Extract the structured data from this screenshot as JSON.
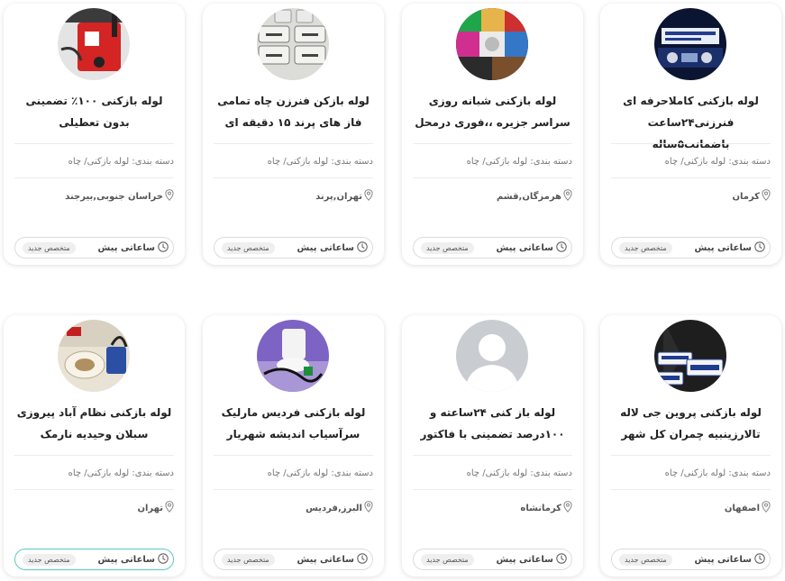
{
  "cards": [
    {
      "title": "لوله بازکنی کاملاحرفه ای فنرزنی۲۴ساعت باضمانت۵ساله",
      "category": "دسته بندی: لوله بازکنی/ چاه",
      "location": "کرمان",
      "time": "ساعاتی پیش",
      "badge": "متخصص جدید",
      "avatar_kind": "photo-banner"
    },
    {
      "title": "لوله بازکنی شبانه روزی سراسر جزیره ،،فوری درمحل",
      "category": "دسته بندی: لوله بازکنی/ چاه",
      "location": "هرمزگان,قشم",
      "time": "ساعاتی پیش",
      "badge": "متخصص جدید",
      "avatar_kind": "photo-collage"
    },
    {
      "title": "لوله بازکن فنرزن چاه تمامی فاز های پرند ۱۵ دقیقه ای",
      "category": "دسته بندی: لوله بازکنی/ چاه",
      "location": "تهران,پرند",
      "time": "ساعاتی پیش",
      "badge": "متخصص جدید",
      "avatar_kind": "photo-keys"
    },
    {
      "title": "لوله بازکنی ۱۰۰٪ تضمینی بدون تعطیلی",
      "category": "دسته بندی: لوله بازکنی/ چاه",
      "location": "خراسان جنوبی,بیرجند",
      "time": "ساعاتی پیش",
      "badge": "متخصص جدید",
      "avatar_kind": "photo-machine"
    },
    {
      "title": "لوله بازکنی پروین جی لاله تالارزینبیه چمران کل شهر",
      "category": "دسته بندی: لوله بازکنی/ چاه",
      "location": "اصفهان",
      "time": "ساعاتی پیش",
      "badge": "متخصص جدید",
      "avatar_kind": "photo-signs"
    },
    {
      "title": "لوله باز کنی ۲۴ساعته و ۱۰۰درصد تضمینی با فاکتور",
      "category": "دسته بندی: لوله بازکنی/ چاه",
      "location": "کرمانشاه",
      "time": "ساعاتی پیش",
      "badge": "متخصص جدید",
      "avatar_kind": "default-person"
    },
    {
      "title": "لوله بازکنی فردیس مارلیک سرآسیاب اندیشه شهریار",
      "category": "دسته بندی: لوله بازکنی/ چاه",
      "location": "البرز,فردیس",
      "time": "ساعاتی پیش",
      "badge": "متخصص جدید",
      "avatar_kind": "photo-toilet"
    },
    {
      "title": "لوله بازکنی نظام آباد پیروزی سبلان وحیدیه نارمک",
      "category": "دسته بندی: لوله بازکنی/ چاه",
      "location": "تهران",
      "time": "ساعاتی پیش",
      "badge": "متخصص جدید",
      "avatar_kind": "photo-squat-toilet"
    }
  ],
  "icons": {
    "location": "location-pin-icon",
    "time": "clock-icon"
  },
  "colors": {
    "active_border": "#5cc9c0"
  }
}
